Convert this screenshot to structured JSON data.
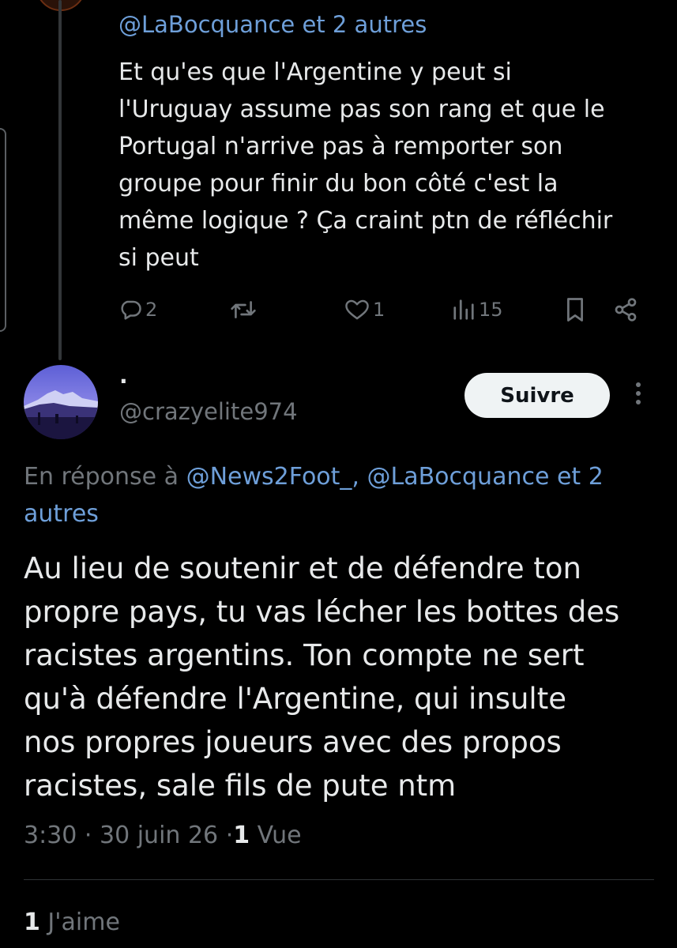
{
  "previous_tweet": {
    "mention_line": "@LaBocquance et 2 autres",
    "text_lines": [
      "Et qu'es que l'Argentine y peut si",
      "l'Uruguay assume pas son rang et que le",
      "Portugal n'arrive pas à remporter son",
      "groupe pour finir du bon côté c'est la",
      "même logique ? Ça craint ptn de réfléchir",
      "si peut"
    ],
    "actions": {
      "reply_icon": "speech-bubble-icon",
      "reply_count": "2",
      "retweet_icon": "retweet-icon",
      "like_icon": "heart-icon",
      "like_count": "1",
      "views_icon": "bar-chart-icon",
      "views_count": "15",
      "bookmark_icon": "bookmark-icon",
      "share_icon": "share-icon"
    }
  },
  "tweet": {
    "display_name": "·",
    "handle": "@crazyelite974",
    "follow_label": "Suivre",
    "more_icon": "vertical-ellipsis-icon",
    "reply_prefix": "En réponse à",
    "reply_mentions": "@News2Foot_, @LaBocquance et 2 autres",
    "text_lines": [
      "Au lieu de soutenir et de défendre ton",
      "propre pays, tu vas lécher les bottes des",
      "racistes argentins. Ton compte ne sert",
      "qu'à défendre l'Argentine, qui insulte",
      "nos propres joueurs avec des propos",
      "racistes, sale fils de pute ntm"
    ],
    "time": "3:30",
    "separator": "·",
    "date": "30 juin 26",
    "views_count": "1",
    "views_label": "Vue",
    "likes_count": "1",
    "likes_label": "J'aime"
  },
  "colors": {
    "background": "#000000",
    "text": "#e7e9ea",
    "secondary": "#71767b",
    "link": "#6e9fd9",
    "button_bg": "#eff3f4"
  }
}
